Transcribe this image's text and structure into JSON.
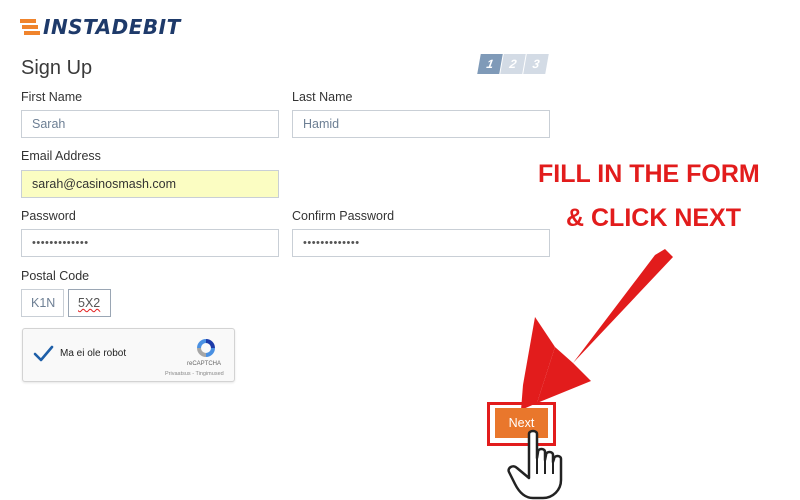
{
  "logo": {
    "text": "INSTADEBIT"
  },
  "page": {
    "title": "Sign Up"
  },
  "steps": [
    "1",
    "2",
    "3"
  ],
  "form": {
    "first_name": {
      "label": "First Name",
      "value": "Sarah"
    },
    "last_name": {
      "label": "Last Name",
      "value": "Hamid"
    },
    "email": {
      "label": "Email Address",
      "value": "sarah@casinosmash.com"
    },
    "password": {
      "label": "Password",
      "value": "•••••••••••••"
    },
    "confirm_password": {
      "label": "Confirm Password",
      "value": "•••••••••••••"
    },
    "postal_code": {
      "label": "Postal Code",
      "part1": "K1N",
      "part2": "5X2"
    }
  },
  "captcha": {
    "label": "Ma ei ole robot",
    "brand": "reCAPTCHA",
    "links": "Privaatsus - Tingimused"
  },
  "instruction": {
    "line1": "FILL IN THE FORM",
    "line2": "& CLICK NEXT"
  },
  "next_button": {
    "label": "Next"
  },
  "colors": {
    "accent": "#e9772c",
    "annotation": "#e21c1c",
    "brand": "#1e3a6a"
  }
}
